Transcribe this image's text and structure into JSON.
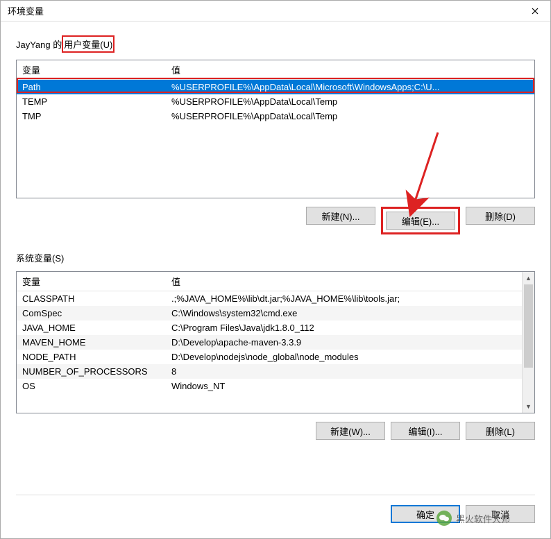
{
  "window_title": "环境变量",
  "user_section": {
    "label_prefix": "JayYang 的",
    "label_boxed": "用户变量(U)",
    "columns": {
      "var": "变量",
      "val": "值"
    },
    "rows": [
      {
        "var": "Path",
        "val": "%USERPROFILE%\\AppData\\Local\\Microsoft\\WindowsApps;C:\\U..."
      },
      {
        "var": "TEMP",
        "val": "%USERPROFILE%\\AppData\\Local\\Temp"
      },
      {
        "var": "TMP",
        "val": "%USERPROFILE%\\AppData\\Local\\Temp"
      }
    ],
    "buttons": {
      "new": "新建(N)...",
      "edit": "编辑(E)...",
      "delete": "删除(D)"
    }
  },
  "sys_section": {
    "label": "系统变量(S)",
    "columns": {
      "var": "变量",
      "val": "值"
    },
    "rows": [
      {
        "var": "CLASSPATH",
        "val": ".;%JAVA_HOME%\\lib\\dt.jar;%JAVA_HOME%\\lib\\tools.jar;"
      },
      {
        "var": "ComSpec",
        "val": "C:\\Windows\\system32\\cmd.exe"
      },
      {
        "var": "JAVA_HOME",
        "val": "C:\\Program Files\\Java\\jdk1.8.0_112"
      },
      {
        "var": "MAVEN_HOME",
        "val": "D:\\Develop\\apache-maven-3.3.9"
      },
      {
        "var": "NODE_PATH",
        "val": "D:\\Develop\\nodejs\\node_global\\node_modules"
      },
      {
        "var": "NUMBER_OF_PROCESSORS",
        "val": "8"
      },
      {
        "var": "OS",
        "val": "Windows_NT"
      }
    ],
    "buttons": {
      "new": "新建(W)...",
      "edit": "编辑(I)...",
      "delete": "删除(L)"
    }
  },
  "dialog_buttons": {
    "ok": "确定",
    "cancel": "取消"
  },
  "watermark": "黑火软件大师"
}
